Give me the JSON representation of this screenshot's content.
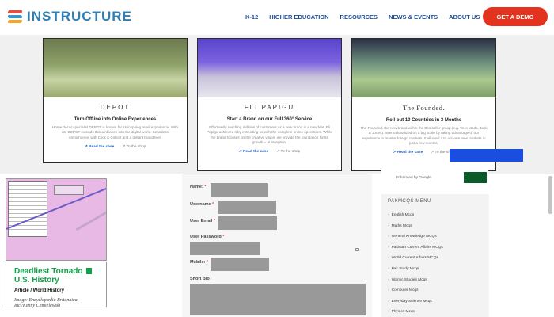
{
  "header": {
    "logo_text": "INSTRUCTURE",
    "nav": [
      "K-12",
      "HIGHER EDUCATION",
      "RESOURCES",
      "NEWS & EVENTS",
      "ABOUT US"
    ],
    "cta": "GET A DEMO"
  },
  "cards": [
    {
      "brand": "DEPOT",
      "title": "Turn Offline into Online Experiences",
      "desc": "Home decor specialist DEPOT is known for its inspiring retail experience. With us, DEPOT extends this ambiance into the digital world. Seamless omnichannel with Click & Collect and a distant brand feel.",
      "read": "Read the case",
      "shop": "To the shop"
    },
    {
      "brand": "FLI PAPIGU",
      "title": "Start a Brand on our Full 360° Service",
      "desc": "Effortlessly reaching millions of customers as a new brand is a new feat. Fli Papigu achieved it by entrusting us with the complete online operations. While the brand focuses on the creative vision, we provide the foundation for its growth – at inception.",
      "read": "Read the case",
      "shop": "To the shop"
    },
    {
      "brand": "The Founded.",
      "title": "Roll out 10 Countries in 3 Months",
      "desc": "The Founded, the new brand within the Bestseller group (e.g. Vero Moda, Jack & Jones). Internationalized on a big scale by taking advantage of our experience to master foreign markets. It allowed it to activate new markets in just a few months.",
      "read": "Read the case",
      "shop": "To the shop"
    }
  ],
  "blue_tab": "",
  "left": {
    "article_title": "Deadliest Tornado in U.S. History",
    "article_title_line1": "Deadliest Tornado",
    "article_title_line2": "U.S. History",
    "in_word": "in",
    "article_sub": "Article / World History",
    "caption": "Image: Encyclopædia Britannica, Inc./Kenny Chmielewski"
  },
  "form": {
    "name": "Name:",
    "username": "Username",
    "user_email": "User Email",
    "user_password": "User Password",
    "mobile": "Mobile:",
    "short_bio": "Short Bio",
    "req": "*"
  },
  "sidebar": {
    "google_label": "Enhanced by Google",
    "heading": "PAKMCQS MENU",
    "items": [
      "English Mcqs",
      "Maths Mcqs",
      "General Knowledge MCQs",
      "Pakistan Current Affairs MCQs",
      "World Current Affairs MCQs",
      "Pak Study Mcqs",
      "Islamic Studies Mcqs",
      "Computer Mcqs",
      "Everyday Science Mcqs",
      "Physics Mcqs"
    ]
  },
  "colors": {
    "brand_blue": "#2d7fb8",
    "nav_blue": "#1f4d9a",
    "cta_red": "#e3331f",
    "tab_blue": "#1a4de0",
    "article_green": "#12a04a"
  }
}
